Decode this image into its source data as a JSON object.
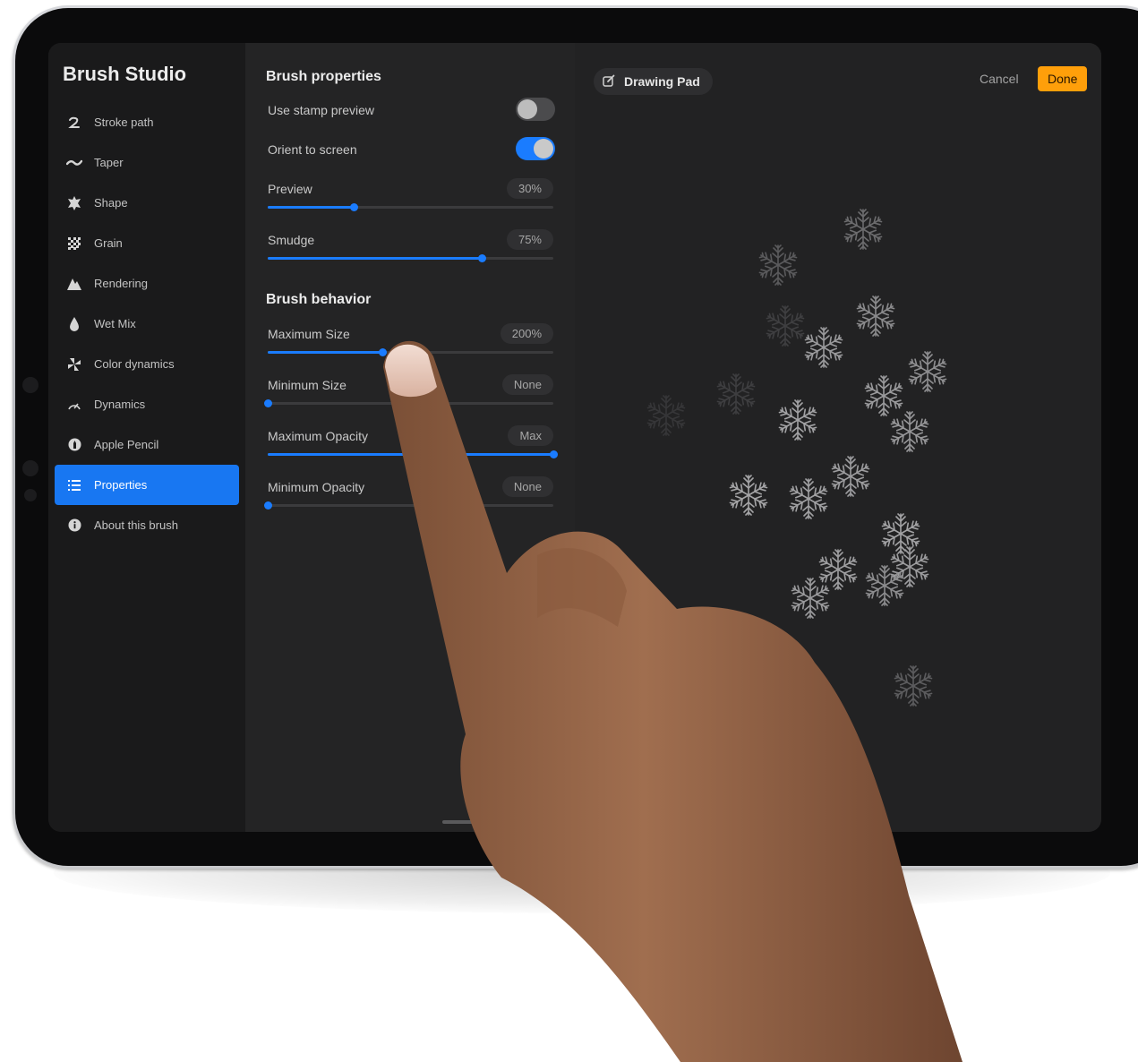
{
  "colors": {
    "accent": "#1a7cff",
    "done": "#ff9f0a"
  },
  "sidebar": {
    "title": "Brush Studio",
    "items": [
      {
        "label": "Stroke path",
        "icon": "stroke-path-icon"
      },
      {
        "label": "Taper",
        "icon": "taper-icon"
      },
      {
        "label": "Shape",
        "icon": "shape-icon"
      },
      {
        "label": "Grain",
        "icon": "grain-icon"
      },
      {
        "label": "Rendering",
        "icon": "rendering-icon"
      },
      {
        "label": "Wet Mix",
        "icon": "wet-mix-icon"
      },
      {
        "label": "Color dynamics",
        "icon": "color-dynamics-icon"
      },
      {
        "label": "Dynamics",
        "icon": "dynamics-icon"
      },
      {
        "label": "Apple Pencil",
        "icon": "apple-pencil-icon"
      },
      {
        "label": "Properties",
        "icon": "properties-icon",
        "active": true
      },
      {
        "label": "About this brush",
        "icon": "info-icon"
      }
    ]
  },
  "properties": {
    "title": "Brush properties",
    "use_stamp_preview": {
      "label": "Use stamp preview",
      "on": false
    },
    "orient_to_screen": {
      "label": "Orient to screen",
      "on": true
    },
    "preview": {
      "label": "Preview",
      "value": "30%",
      "level": 0.3
    },
    "smudge": {
      "label": "Smudge",
      "value": "75%",
      "level": 0.75
    }
  },
  "behavior": {
    "title": "Brush behavior",
    "maximum_size": {
      "label": "Maximum Size",
      "value": "200%",
      "level": 0.4
    },
    "minimum_size": {
      "label": "Minimum Size",
      "value": "None",
      "level": 0.0
    },
    "maximum_opacity": {
      "label": "Maximum Opacity",
      "value": "Max",
      "level": 1.0
    },
    "minimum_opacity": {
      "label": "Minimum Opacity",
      "value": "None",
      "level": 0.0
    }
  },
  "pad": {
    "title": "Drawing Pad",
    "cancel_label": "Cancel",
    "done_label": "Done"
  }
}
